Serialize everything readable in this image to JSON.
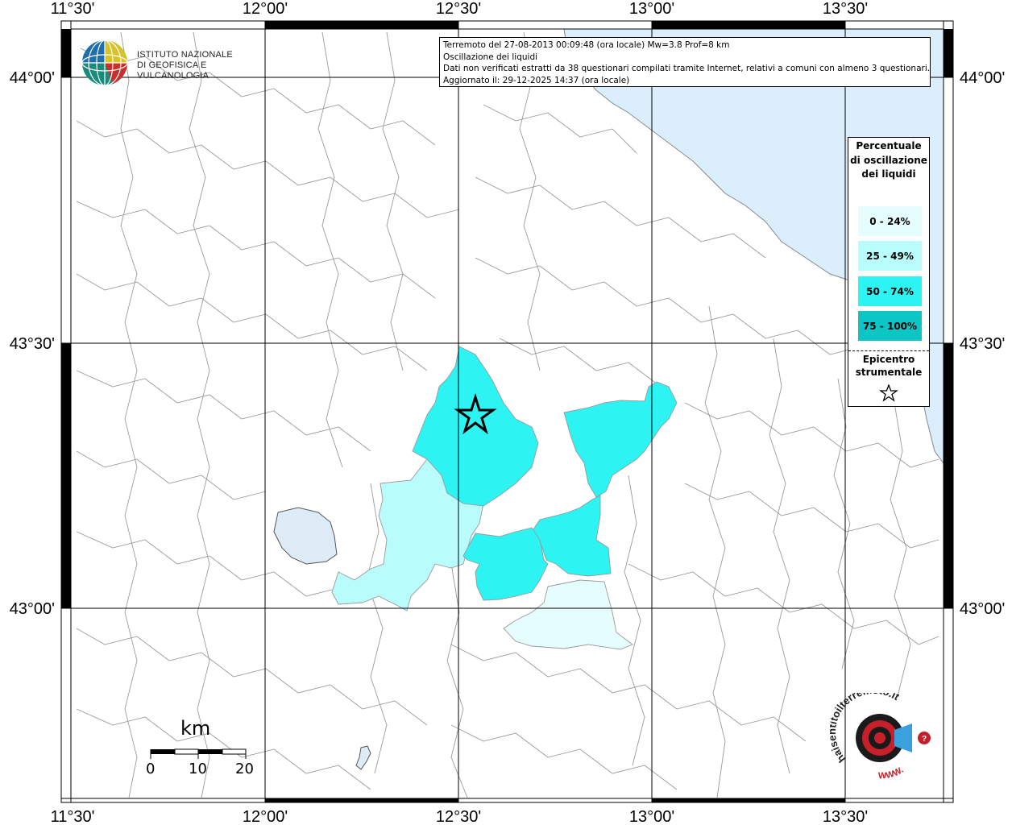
{
  "info": {
    "line1": "Terremoto del 27-08-2013 00:09:48 (ora locale) Mw=3.8 Prof=8 km",
    "line2": "Oscillazione dei liquidi",
    "line3": "Dati non verificati estratti da 38 questionari compilati tramite Internet, relativi a comuni con almeno 3 questionari.",
    "line4": "Aggiornato il: 29-12-2025 14:37 (ora locale)"
  },
  "axes": {
    "top_lon": [
      "11°30'",
      "12°00'",
      "12°30'",
      "13°00'",
      "13°30'"
    ],
    "bottom_lon": [
      "11°30'",
      "12°00'",
      "12°30'",
      "13°00'",
      "13°30'"
    ],
    "left_lat": [
      "44°00'",
      "43°30'",
      "43°00'"
    ],
    "right_lat": [
      "44°00'",
      "43°30'",
      "43°00'"
    ]
  },
  "legend": {
    "title": "Percentuale di oscillazione dei liquidi",
    "classes": [
      {
        "label": "0 - 24%",
        "color": "#e6fdfd"
      },
      {
        "label": "25 - 49%",
        "color": "#b9fcfc"
      },
      {
        "label": "50 - 74%",
        "color": "#2ef3f3"
      },
      {
        "label": "75 - 100%",
        "color": "#0cc6c6"
      }
    ],
    "epicenter_label": "Epicentro strumentale"
  },
  "logo": {
    "ingv_line1": "ISTITUTO NAZIONALE",
    "ingv_line2": "DI GEOFISICA E VULCANOLOGIA",
    "hsi_text": "haisentitoilterremoto.it",
    "hsi_url": "WWW."
  },
  "scale": {
    "unit": "km",
    "ticks": [
      "0",
      "10",
      "20"
    ]
  },
  "colors": {
    "sea": "#dbeefc",
    "lake": "#ddebf7",
    "border": "#9a9a9a",
    "grid": "#000000"
  }
}
